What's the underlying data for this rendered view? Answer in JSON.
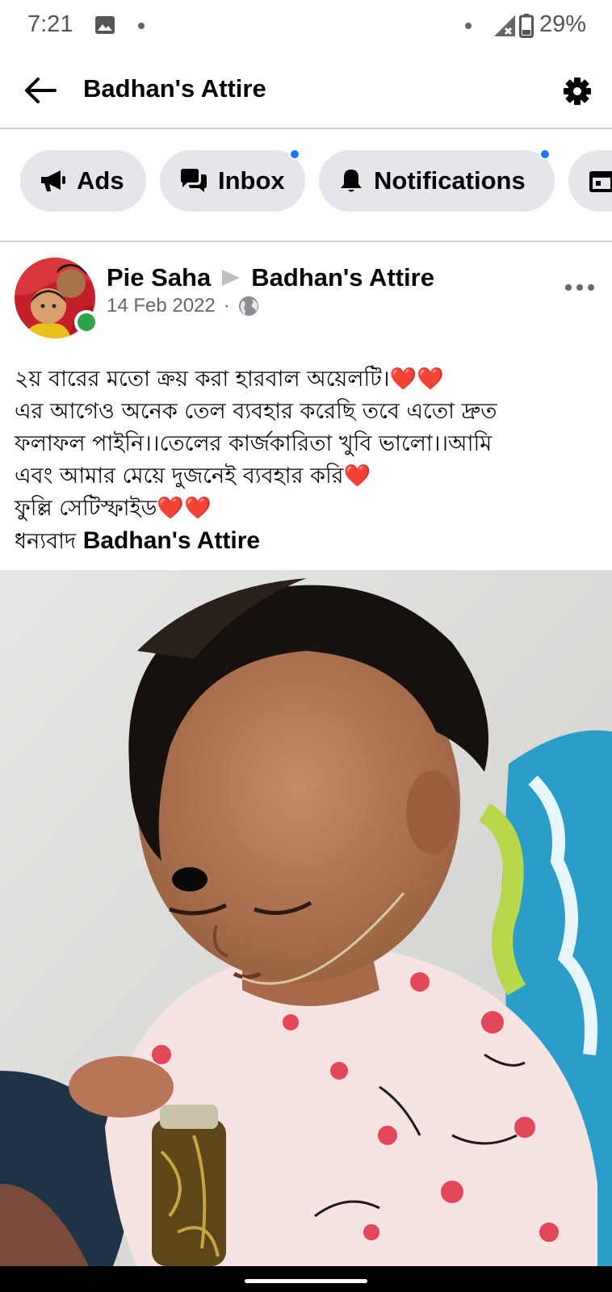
{
  "status_bar": {
    "time": "7:21",
    "battery_percent": "29%"
  },
  "header": {
    "title": "Badhan's Attire"
  },
  "chips": [
    {
      "label": "Ads",
      "icon": "megaphone-icon",
      "has_dot": false
    },
    {
      "label": "Inbox",
      "icon": "chat-bubbles-icon",
      "has_dot": true
    },
    {
      "label": "Notifications",
      "icon": "bell-icon",
      "has_dot": true
    }
  ],
  "post": {
    "author": "Pie Saha",
    "page": "Badhan's Attire",
    "date": "14 Feb 2022",
    "audience_icon": "globe-icon",
    "text_lines": [
      "২য় বারের মতো ক্রয় করা হারবাল অয়েলটি।",
      "এর আগেও অনেক তেল ব্যবহার করেছি তবে এতো দ্রুত",
      "ফলাফল পাইনি।।তেলের কার্জকারিতা খুবি ভালো।।আমি",
      "এবং আমার মেয়ে দুজনেই ব্যবহার করি",
      "ফুল্লি সেটিস্ফাইড",
      "ধন্যবাদ "
    ],
    "tagged_page": "Badhan's Attire",
    "hearts": {
      "line1": "❤️❤️",
      "line4": "❤️",
      "line5": "❤️❤️"
    }
  },
  "colors": {
    "accent_blue": "#1877f2",
    "chip_bg": "#e4e6eb",
    "online_green": "#31a24c",
    "secondary_text": "#65676b",
    "heart_red": "#e0101e"
  }
}
